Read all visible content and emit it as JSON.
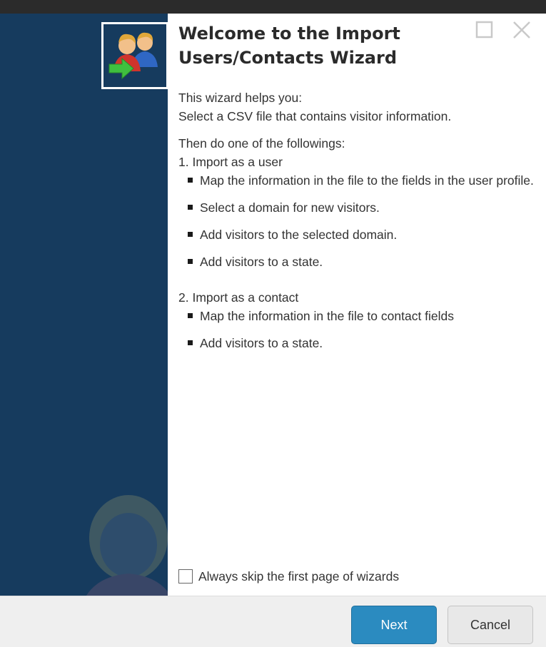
{
  "window": {
    "maximize_icon": "maximize-icon",
    "close_icon": "close-icon"
  },
  "wizard": {
    "icon": "import-users-icon",
    "title": "Welcome to the Import Users/Contacts Wizard",
    "intro_line1": "This wizard helps you:",
    "intro_line2": "Select a CSV file that contains visitor information.",
    "then_line": "Then do one of the followings:",
    "section1": {
      "heading": "1. Import as a user",
      "bullets": [
        "Map the information in the file to the fields in the user profile.",
        "Select a domain for new visitors.",
        "Add visitors to the selected domain.",
        "Add visitors to a state."
      ]
    },
    "section2": {
      "heading": "2. Import as a contact",
      "bullets": [
        "Map the information in the file to contact fields",
        "Add visitors to a state."
      ]
    },
    "skip_checkbox": {
      "label": "Always skip the first page of wizards",
      "checked": false
    }
  },
  "footer": {
    "next_label": "Next",
    "cancel_label": "Cancel"
  },
  "colors": {
    "sidebar": "#163b5e",
    "primary_button": "#2b8bc0",
    "footer_bg": "#efefef"
  }
}
